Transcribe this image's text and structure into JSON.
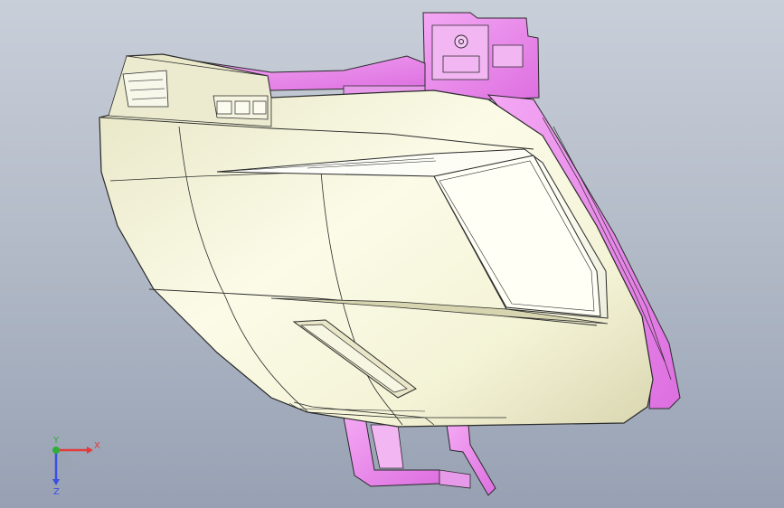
{
  "viewport": {
    "background_top": "#c9cfd9",
    "background_bottom": "#97a1b3"
  },
  "model": {
    "body_color": "#f4f4dd",
    "housing_color": "#ee8ff0",
    "edge_color": "#2a2a2a"
  },
  "triad": {
    "x_label": "X",
    "y_label": "Y",
    "z_label": "Z",
    "x_color": "#e23b3b",
    "y_color": "#2fae3a",
    "z_color": "#3b4fe2"
  }
}
